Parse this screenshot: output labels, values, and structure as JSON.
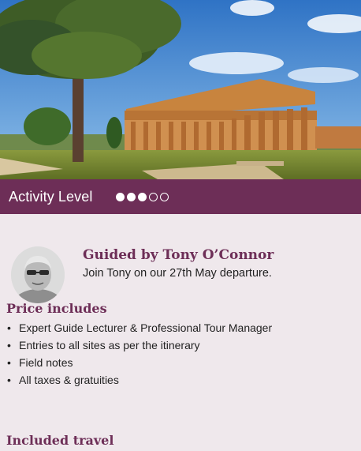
{
  "hero": {
    "image": "temple-ruins-photo"
  },
  "activity": {
    "label": "Activity Level",
    "level": 3,
    "max": 5
  },
  "guide": {
    "title": "Guided by Tony O’Connor",
    "subtitle": "Join Tony on our 27th May departure.",
    "avatar": "guide-portrait-photo"
  },
  "price": {
    "heading": "Price includes",
    "items": [
      "Expert Guide Lecturer & Professional Tour Manager",
      "Entries to all sites as per the itinerary",
      "Field notes",
      "All taxes & gratuities"
    ]
  },
  "travel": {
    "heading": "Included travel"
  },
  "colors": {
    "brand": "#6d2e57",
    "panel": "#efe8ec"
  }
}
